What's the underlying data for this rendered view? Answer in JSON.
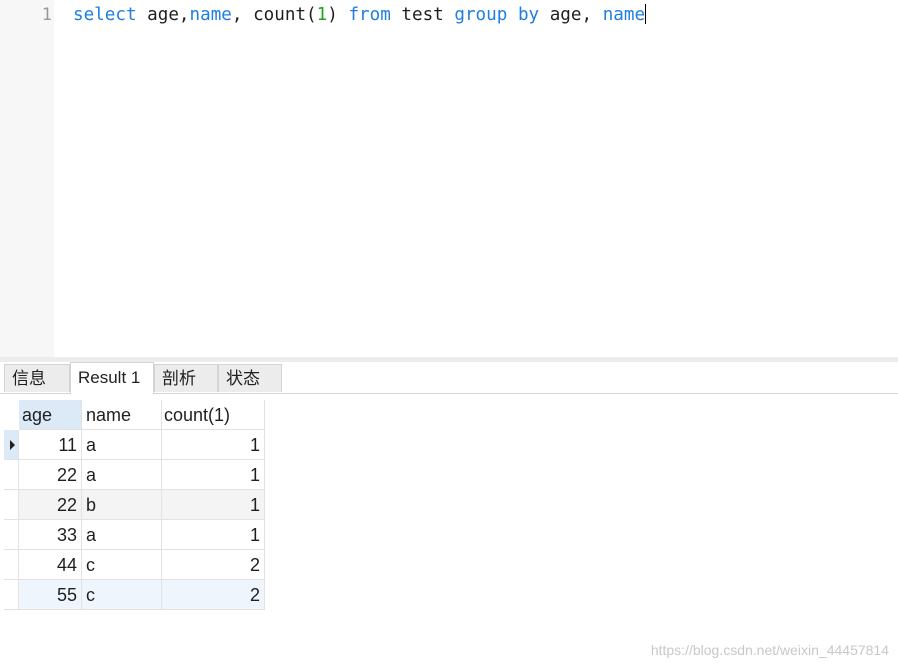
{
  "editor": {
    "line_number": "1",
    "tokens": {
      "t1": "select",
      "t2": " age,",
      "t3": "name",
      "t4": ", count(",
      "t5": "1",
      "t6": ") ",
      "t7": "from",
      "t8": " test ",
      "t9": "group",
      "t10": " ",
      "t11": "by",
      "t12": " age, ",
      "t13": "name"
    }
  },
  "tabs": [
    {
      "label": "信息"
    },
    {
      "label": "Result 1"
    },
    {
      "label": "剖析"
    },
    {
      "label": "状态"
    }
  ],
  "grid": {
    "columns": [
      "age",
      "name",
      "count(1)"
    ],
    "rows": [
      {
        "age": "11",
        "name": "a",
        "count": "1"
      },
      {
        "age": "22",
        "name": "a",
        "count": "1"
      },
      {
        "age": "22",
        "name": "b",
        "count": "1"
      },
      {
        "age": "33",
        "name": "a",
        "count": "1"
      },
      {
        "age": "44",
        "name": "c",
        "count": "2"
      },
      {
        "age": "55",
        "name": "c",
        "count": "2"
      }
    ]
  },
  "watermark": "https://blog.csdn.net/weixin_44457814",
  "colors": {
    "keyword": "#1f7fe0",
    "number": "#1aa51a",
    "selection": "#dceaf8"
  }
}
